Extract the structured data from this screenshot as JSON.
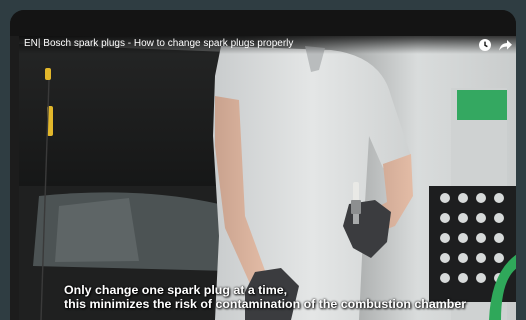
{
  "video": {
    "title": "EN| Bosch spark plugs - How to change spark plugs properly",
    "subtitle_line1": "Only change one spark plug at a time,",
    "subtitle_line2": "this minimizes the risk of contamination of the combustion chamber"
  },
  "icons": {
    "watch_later": "clock-icon",
    "share": "share-arrow-icon"
  },
  "colors": {
    "page_background": "#2f3d42",
    "bosch_green": "#34a861",
    "glove": "#3b3c3f"
  }
}
